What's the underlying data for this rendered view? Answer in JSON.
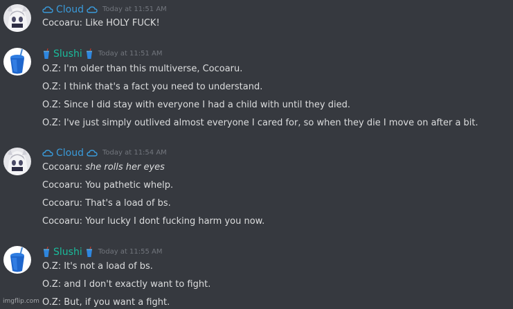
{
  "colors": {
    "background": "#36393f",
    "cloud_name": "#3a9ad9",
    "slushi_name": "#1abc9c",
    "timestamp": "#72767d",
    "text": "#dcddde"
  },
  "groups": [
    {
      "user": "Cloud",
      "deco_icon": "cloud-icon",
      "avatar_icon": "anime-avatar-icon",
      "time": "Today at 11:51 AM",
      "lines": [
        {
          "speaker": "Cocoaru:",
          "text": "Like HOLY FUCK!",
          "italic": ""
        }
      ]
    },
    {
      "user": "Slushi",
      "deco_icon": "cup-icon",
      "avatar_icon": "slushie-avatar-icon",
      "time": "Today at 11:51 AM",
      "lines": [
        {
          "speaker": "O.Z:",
          "text": "I'm older than this multiverse, Cocoaru.",
          "italic": ""
        },
        {
          "speaker": "O.Z:",
          "text": "I think that's a fact you need to understand.",
          "italic": ""
        },
        {
          "speaker": "O.Z:",
          "text": "Since I did stay with everyone I had a child with until they died.",
          "italic": ""
        },
        {
          "speaker": "O.Z:",
          "text": "I've just simply outlived almost everyone I cared for, so when they die I move on after a bit.",
          "italic": ""
        }
      ]
    },
    {
      "user": "Cloud",
      "deco_icon": "cloud-icon",
      "avatar_icon": "anime-avatar-icon",
      "time": "Today at 11:54 AM",
      "lines": [
        {
          "speaker": "Cocoaru:",
          "text": "",
          "italic": "she rolls her eyes"
        },
        {
          "speaker": "Cocoaru:",
          "text": "You pathetic whelp.",
          "italic": ""
        },
        {
          "speaker": "Cocoaru:",
          "text": "That's a load of bs.",
          "italic": ""
        },
        {
          "speaker": "Cocoaru:",
          "text": "Your lucky I dont fucking harm you now.",
          "italic": ""
        }
      ]
    },
    {
      "user": "Slushi",
      "deco_icon": "cup-icon",
      "avatar_icon": "slushie-avatar-icon",
      "time": "Today at 11:55 AM",
      "lines": [
        {
          "speaker": "O.Z:",
          "text": "It's not a load of bs.",
          "italic": ""
        },
        {
          "speaker": "O.Z:",
          "text": "and I don't exactly want to fight.",
          "italic": ""
        },
        {
          "speaker": "O.Z:",
          "text": "But, if you want a fight.",
          "italic": ""
        }
      ]
    }
  ],
  "watermark": "imgflip.com"
}
